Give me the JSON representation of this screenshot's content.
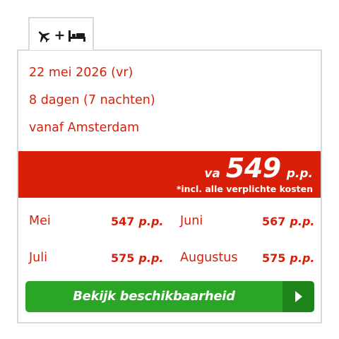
{
  "tab": {
    "icons": [
      "airplane-icon",
      "plus",
      "bed-icon"
    ],
    "plus_label": "+"
  },
  "trip": {
    "date": "22 mei 2026 (vr)",
    "duration": "8 dagen (7 nachten)",
    "departure": "vanaf Amsterdam"
  },
  "price": {
    "prefix": "va",
    "amount": "549",
    "suffix": "p.p.",
    "note": "*incl. alle verplichte kosten"
  },
  "months": [
    {
      "name": "Mei",
      "price": "547",
      "unit": "p.p."
    },
    {
      "name": "Juni",
      "price": "567",
      "unit": "p.p."
    },
    {
      "name": "Juli",
      "price": "575",
      "unit": "p.p."
    },
    {
      "name": "Augustus",
      "price": "575",
      "unit": "p.p."
    }
  ],
  "cta": {
    "label": "Bekijk beschikbaarheid",
    "icon": "arrow-right-icon"
  },
  "colors": {
    "accent_red": "#d71f0a",
    "button_green": "#2aa525",
    "button_green_dark": "#1d8419",
    "border_gray": "#d9d9d9"
  }
}
